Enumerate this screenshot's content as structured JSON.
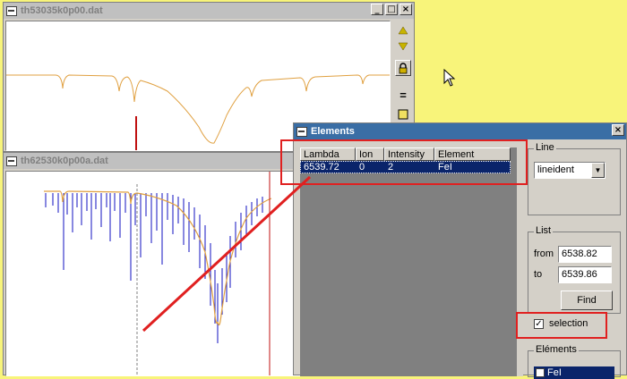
{
  "window1": {
    "title": "th53035k0p00.dat"
  },
  "window2": {
    "title": "th62530k0p00a.dat"
  },
  "elements_window": {
    "title": "Elements",
    "columns": [
      "Lambda",
      "Ion",
      "Intensity",
      "Element"
    ],
    "rows": [
      {
        "lambda": "6539.72",
        "ion": "0",
        "intensity": "2",
        "element": "FeI"
      }
    ],
    "line_group": {
      "label": "Line",
      "selected": "lineident"
    },
    "list_group": {
      "label": "List",
      "from_label": "from",
      "from_value": "6538.82",
      "to_label": "to",
      "to_value": "6539.86",
      "find_label": "Find"
    },
    "selection_label": "selection",
    "selection_checked": true,
    "elements_group": {
      "label": "Eléments",
      "first_item": "FeI"
    }
  },
  "colors": {
    "desktop": "#f8f47a",
    "spectrum_orange": "#e0a040",
    "line_blue": "#1010c0",
    "annotation_red": "#e02020",
    "selection_blue": "#0a246a"
  },
  "icons": {
    "up": "arrow-up-icon",
    "down": "arrow-down-icon",
    "lock": "lock-icon",
    "equal": "equal-icon",
    "frame": "frame-icon",
    "cursor": "mouse-cursor-icon"
  }
}
